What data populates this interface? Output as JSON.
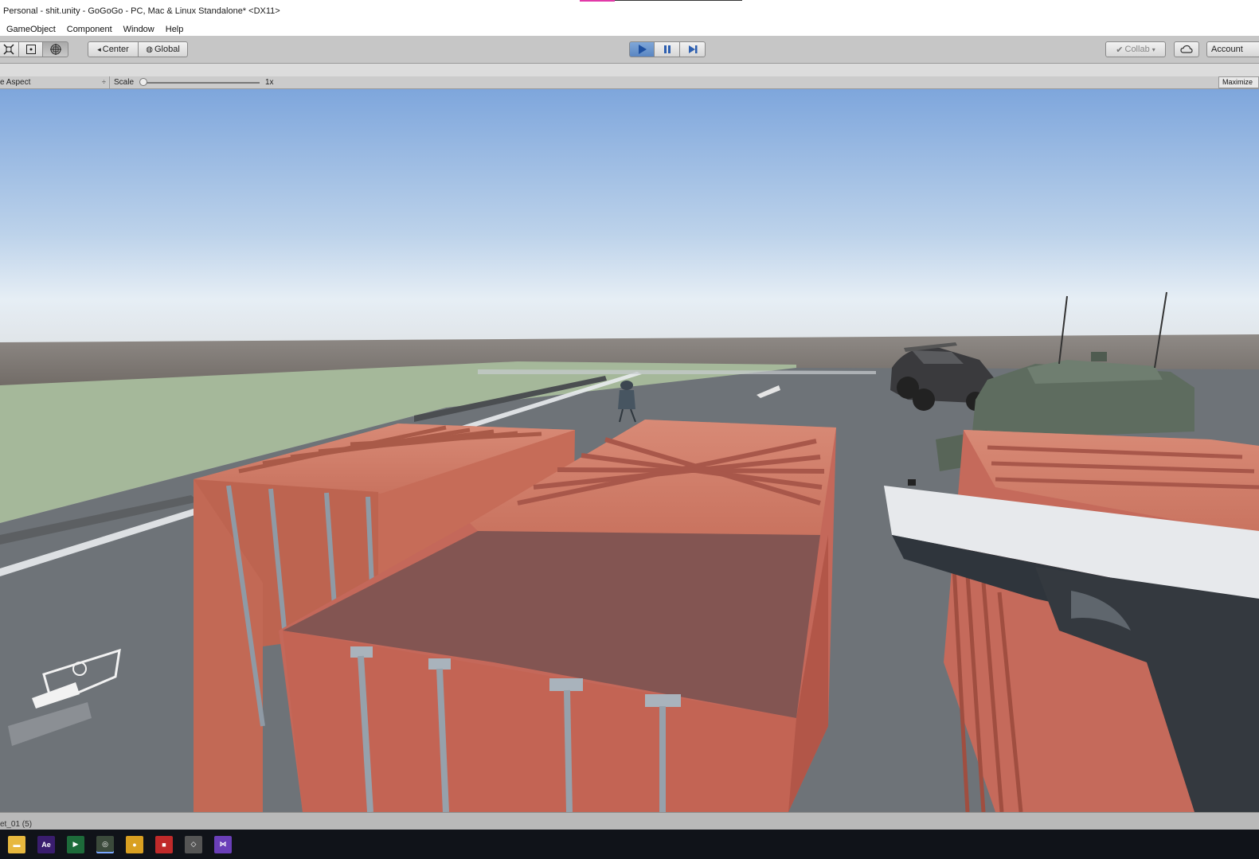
{
  "window": {
    "title": "Personal - shit.unity - GoGoGo - PC, Mac & Linux Standalone* <DX11>"
  },
  "menu": {
    "items": [
      "GameObject",
      "Component",
      "Window",
      "Help"
    ]
  },
  "toolbar": {
    "pivot_label": "Center",
    "space_label": "Global",
    "collab_label": "Collab",
    "account_label": "Account"
  },
  "game_view": {
    "aspect_label": "e Aspect",
    "aspect_arrow": "÷",
    "scale_label": "Scale",
    "scale_value": "1x",
    "maximize_label": "Maximize"
  },
  "status": {
    "text": "et_01 (5)"
  },
  "taskbar": {
    "icons": [
      {
        "name": "file-explorer-icon",
        "glyph": "▬",
        "color": "#e7b83e"
      },
      {
        "name": "after-effects-icon",
        "glyph": "Ae",
        "color": "#3a1d6e"
      },
      {
        "name": "terminal-icon",
        "glyph": "▶",
        "color": "#1d6b3a"
      },
      {
        "name": "unity-icon",
        "glyph": "◎",
        "color": "#3b4a3b"
      },
      {
        "name": "chrome-icon",
        "glyph": "●",
        "color": "#d9a021"
      },
      {
        "name": "red-app-icon",
        "glyph": "■",
        "color": "#c02a2a"
      },
      {
        "name": "unity-hub-icon",
        "glyph": "◇",
        "color": "#555"
      },
      {
        "name": "visual-studio-icon",
        "glyph": "⋈",
        "color": "#6a3fb8"
      }
    ]
  },
  "colors": {
    "play_active": "#5a86c2",
    "container": "#c8705f",
    "ground": "#6e7378",
    "sky_top": "#7ea6dc"
  }
}
